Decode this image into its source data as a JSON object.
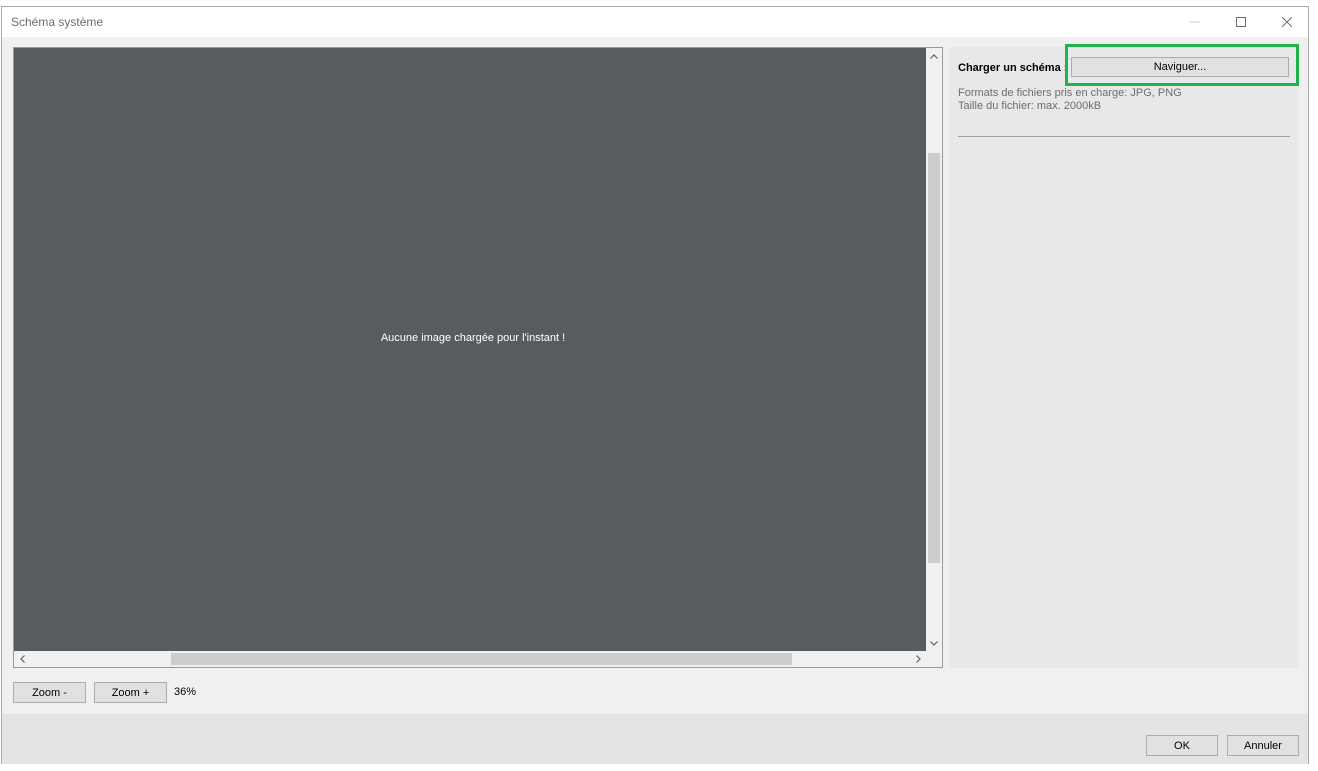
{
  "window": {
    "title": "Schéma système"
  },
  "viewer": {
    "empty_message": "Aucune image chargée pour l'instant !"
  },
  "side_panel": {
    "load_label": "Charger un schéma :",
    "browse_label": "Naviguer...",
    "formats_text": "Formats de fichiers pris en charge: JPG, PNG",
    "size_text": "Taille du fichier: max. 2000kB"
  },
  "zoom": {
    "zoom_out_label": "Zoom -",
    "zoom_in_label": "Zoom +",
    "level": "36%"
  },
  "footer": {
    "ok_label": "OK",
    "cancel_label": "Annuler"
  },
  "colors": {
    "canvas_bg": "#585c5f",
    "highlight": "#22b14c"
  },
  "icons": {
    "minimize": "minimize-icon",
    "maximize": "maximize-icon",
    "close": "close-icon",
    "scroll_up": "chevron-up-icon",
    "scroll_down": "chevron-down-icon",
    "scroll_left": "chevron-left-icon",
    "scroll_right": "chevron-right-icon"
  }
}
